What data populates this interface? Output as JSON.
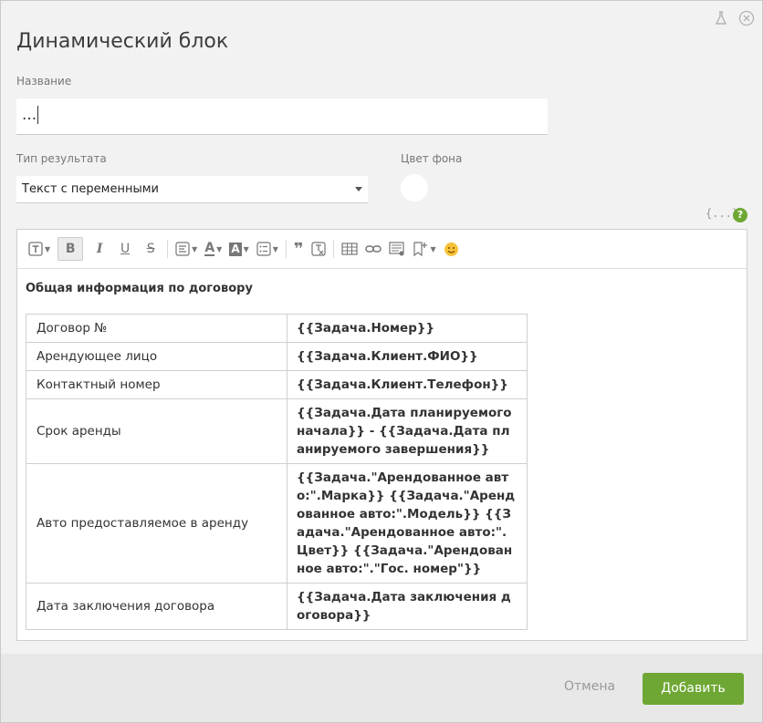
{
  "dialog": {
    "title": "Динамический блок",
    "name_label": "Название",
    "name_value": "...",
    "result_type_label": "Тип результата",
    "result_type_value": "Текст с переменными",
    "bg_color_label": "Цвет фона",
    "bg_color": "#ffffff",
    "variables_icon": "{...}",
    "help_icon": "?"
  },
  "icons": {
    "flask": "flask-icon",
    "close": "close-icon"
  },
  "editor": {
    "heading": "Общая информация по договору",
    "rows": [
      {
        "key": "Договор №",
        "value": "{{Задача.Номер}}"
      },
      {
        "key": "Арендующее лицо",
        "value": "{{Задача.Клиент.ФИО}}"
      },
      {
        "key": "Контактный номер",
        "value": "{{Задача.Клиент.Телефон}}"
      },
      {
        "key": "Срок аренды",
        "value": "{{Задача.Дата планируемого начала}} -  {{Задача.Дата планируемого завершения}}"
      },
      {
        "key": "Авто предоставляемое в аренду",
        "value": "{{Задача.\"Арендованное авто:\".Марка}} {{Задача.\"Арендованное авто:\".Модель}} {{Задача.\"Арендованное авто:\".Цвет}} {{Задача.\"Арендованное авто:\".\"Гос. номер\"}}"
      },
      {
        "key": "Дата заключения договора",
        "value": "{{Задача.Дата заключения договора}}"
      }
    ]
  },
  "footer": {
    "cancel_label": "Отмена",
    "add_label": "Добавить"
  },
  "colors": {
    "accent": "#6ea734"
  }
}
